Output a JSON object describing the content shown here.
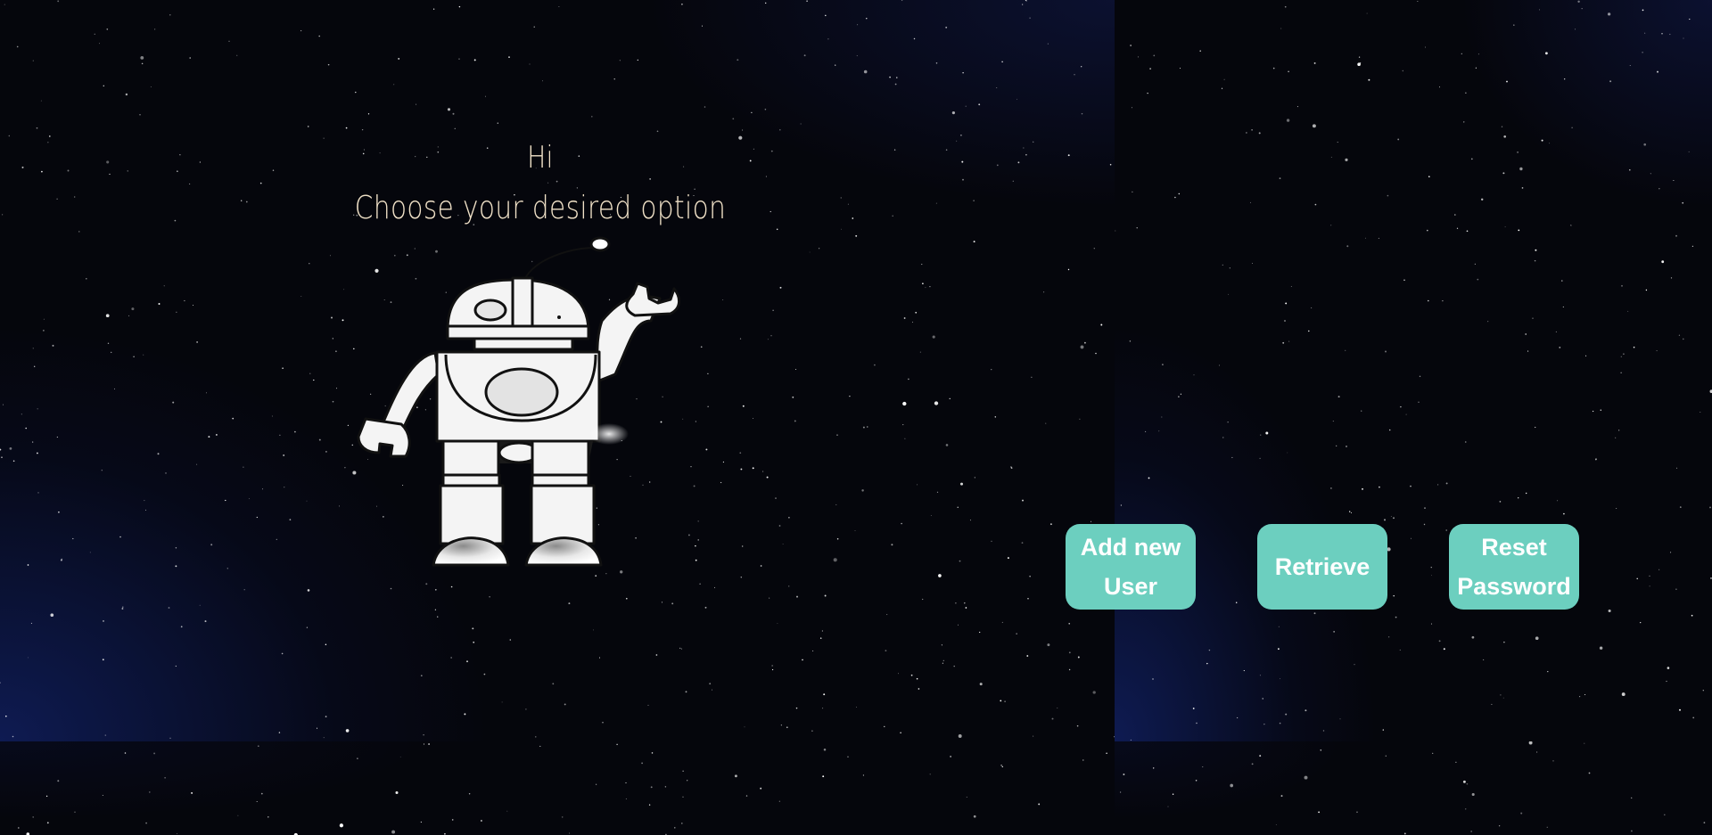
{
  "greeting": {
    "title": "Hi",
    "subtitle": "Choose your desired option"
  },
  "illustration": {
    "icon": "robot-icon"
  },
  "actions": {
    "add_user_label": "Add new User",
    "retrieve_label": "Retrieve",
    "reset_password_label": "Reset Password"
  },
  "colors": {
    "background": "#05060c",
    "text": "#f1e2c8",
    "button": "#6ccfbf",
    "button_text": "#ffffff"
  }
}
